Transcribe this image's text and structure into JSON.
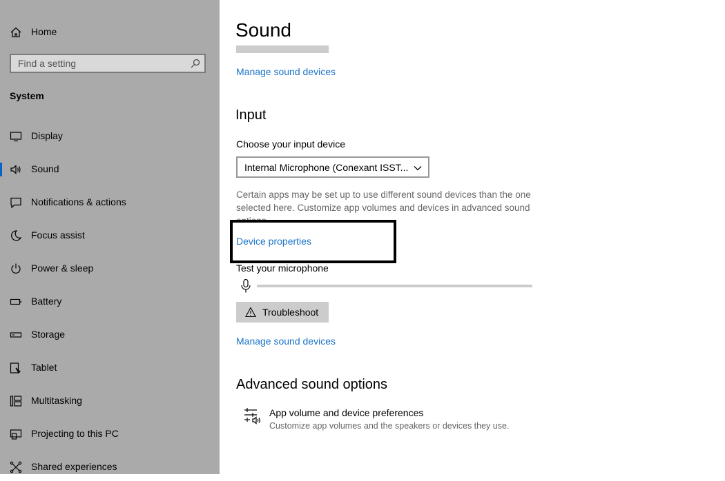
{
  "sidebar": {
    "home_label": "Home",
    "search_placeholder": "Find a setting",
    "section_title": "System",
    "items": [
      {
        "label": "Display",
        "icon": "display-icon"
      },
      {
        "label": "Sound",
        "icon": "speaker-icon",
        "selected": true
      },
      {
        "label": "Notifications & actions",
        "icon": "notification-icon"
      },
      {
        "label": "Focus assist",
        "icon": "moon-icon"
      },
      {
        "label": "Power & sleep",
        "icon": "power-icon"
      },
      {
        "label": "Battery",
        "icon": "battery-icon"
      },
      {
        "label": "Storage",
        "icon": "storage-icon"
      },
      {
        "label": "Tablet",
        "icon": "tablet-icon"
      },
      {
        "label": "Multitasking",
        "icon": "multitasking-icon"
      },
      {
        "label": "Projecting to this PC",
        "icon": "projecting-icon"
      },
      {
        "label": "Shared experiences",
        "icon": "shared-experiences-icon"
      }
    ]
  },
  "main": {
    "title": "Sound",
    "output": {
      "manage_link": "Manage sound devices"
    },
    "input": {
      "heading": "Input",
      "choose_label": "Choose your input device",
      "selected_device": "Internal Microphone (Conexant ISST...",
      "description": "Certain apps may be set up to use different sound devices than the one selected here. Customize app volumes and devices in advanced sound options.",
      "device_properties_link": "Device properties",
      "test_label": "Test your microphone",
      "mic_level": 0,
      "troubleshoot_label": "Troubleshoot",
      "manage_link": "Manage sound devices"
    },
    "advanced": {
      "heading": "Advanced sound options",
      "pref_title": "App volume and device preferences",
      "pref_desc": "Customize app volumes and the speakers or devices they use."
    }
  },
  "colors": {
    "sidebar_bg": "#aaaaaa",
    "link": "#1a73c9",
    "accent": "#0a62c9",
    "button_bg": "#cccccc"
  }
}
